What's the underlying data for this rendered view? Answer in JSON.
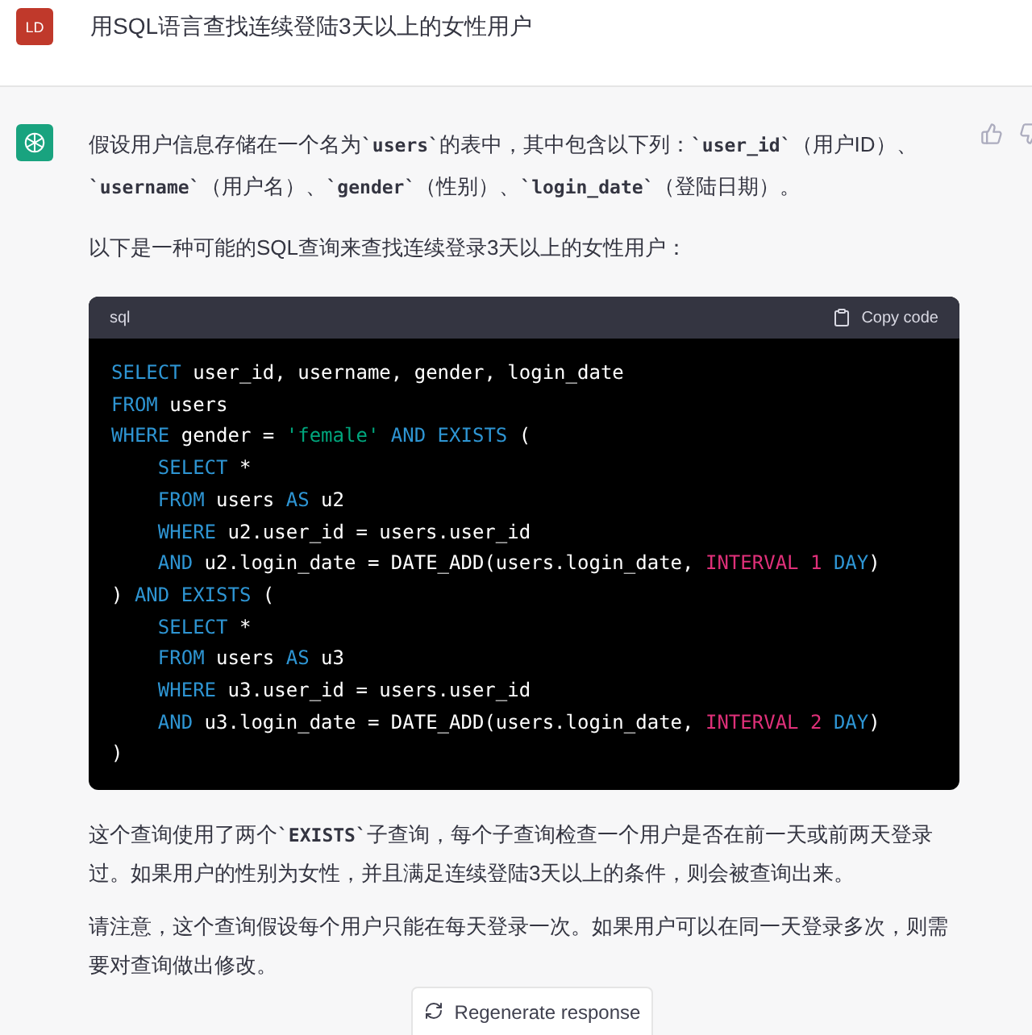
{
  "user_message": {
    "avatar": "LD",
    "text": "用SQL语言查找连续登陆3天以上的女性用户"
  },
  "assistant_message": {
    "intro": [
      {
        "kind": "text",
        "text": "假设用户信息存储在一个名为"
      },
      {
        "kind": "code",
        "text": "`users`"
      },
      {
        "kind": "text",
        "text": "的表中，其中包含以下列："
      },
      {
        "kind": "code",
        "text": "`user_id`"
      },
      {
        "kind": "text",
        "text": "（用户ID）、"
      },
      {
        "kind": "code",
        "text": "`username`"
      },
      {
        "kind": "text",
        "text": "（用户名）、"
      },
      {
        "kind": "code",
        "text": "`gender`"
      },
      {
        "kind": "text",
        "text": "（性别）、"
      },
      {
        "kind": "code",
        "text": "`login_date`"
      },
      {
        "kind": "text",
        "text": "（登陆日期）。"
      }
    ],
    "lead": [
      {
        "kind": "text",
        "text": "以下是一种可能的SQL查询来查找连续登录3天以上的女性用户："
      }
    ],
    "code_block": {
      "language": "sql",
      "copy_label": "Copy code",
      "lines": [
        [
          {
            "kind": "keyword",
            "text": "SELECT"
          },
          {
            "kind": "plain",
            "text": " user_id, username, gender, login_date"
          }
        ],
        [
          {
            "kind": "keyword",
            "text": "FROM"
          },
          {
            "kind": "plain",
            "text": " users"
          }
        ],
        [
          {
            "kind": "keyword",
            "text": "WHERE"
          },
          {
            "kind": "plain",
            "text": " gender = "
          },
          {
            "kind": "string",
            "text": "'female' "
          },
          {
            "kind": "keyword",
            "text": "AND EXISTS"
          },
          {
            "kind": "plain",
            "text": " ("
          }
        ],
        [
          {
            "kind": "keyword",
            "text": "SELECT",
            "indent": true
          },
          {
            "kind": "plain",
            "text": " *"
          }
        ],
        [
          {
            "kind": "keyword",
            "text": "FROM",
            "indent": true
          },
          {
            "kind": "plain",
            "text": " users "
          },
          {
            "kind": "keyword",
            "text": "AS"
          },
          {
            "kind": "plain",
            "text": " u2"
          }
        ],
        [
          {
            "kind": "keyword",
            "text": "WHERE",
            "indent": true
          },
          {
            "kind": "plain",
            "text": " u2.user_id = users.user_id"
          }
        ],
        [
          {
            "kind": "keyword",
            "text": "AND",
            "indent": true
          },
          {
            "kind": "plain",
            "text": " u2.login_date = DATE_ADD(users.login_date, "
          },
          {
            "kind": "literal",
            "text": "INTERVAL 1 "
          },
          {
            "kind": "keyword",
            "text": "DAY"
          },
          {
            "kind": "plain",
            "text": ")"
          }
        ],
        [
          {
            "kind": "plain",
            "text": ") "
          },
          {
            "kind": "keyword",
            "text": "AND EXISTS"
          },
          {
            "kind": "plain",
            "text": " ("
          }
        ],
        [
          {
            "kind": "keyword",
            "text": "SELECT",
            "indent": true
          },
          {
            "kind": "plain",
            "text": " *"
          }
        ],
        [
          {
            "kind": "keyword",
            "text": "FROM",
            "indent": true
          },
          {
            "kind": "plain",
            "text": " users "
          },
          {
            "kind": "keyword",
            "text": "AS"
          },
          {
            "kind": "plain",
            "text": " u3"
          }
        ],
        [
          {
            "kind": "keyword",
            "text": "WHERE",
            "indent": true
          },
          {
            "kind": "plain",
            "text": " u3.user_id = users.user_id"
          }
        ],
        [
          {
            "kind": "keyword",
            "text": "AND",
            "indent": true
          },
          {
            "kind": "plain",
            "text": " u3.login_date = DATE_ADD(users.login_date, "
          },
          {
            "kind": "literal",
            "text": "INTERVAL 2 "
          },
          {
            "kind": "keyword",
            "text": "DAY"
          },
          {
            "kind": "plain",
            "text": ")"
          }
        ],
        [
          {
            "kind": "plain",
            "text": ")"
          }
        ]
      ]
    },
    "explanation": [
      {
        "kind": "text",
        "text": "这个查询使用了两个"
      },
      {
        "kind": "code",
        "text": "`EXISTS`"
      },
      {
        "kind": "text",
        "text": "子查询，每个子查询检查一个用户是否在前一天或前两天登录过。如果用户的性别为女性，并且满足连续登陆3天以上的条件，则会被查询出来。"
      }
    ],
    "note": [
      {
        "kind": "text",
        "text": "请注意，这个查询假设每个用户只能在每天登录一次。如果用户可以在同一天登录多次，则需要对查询做出修改。"
      }
    ]
  },
  "regenerate_button": "Regenerate response"
}
